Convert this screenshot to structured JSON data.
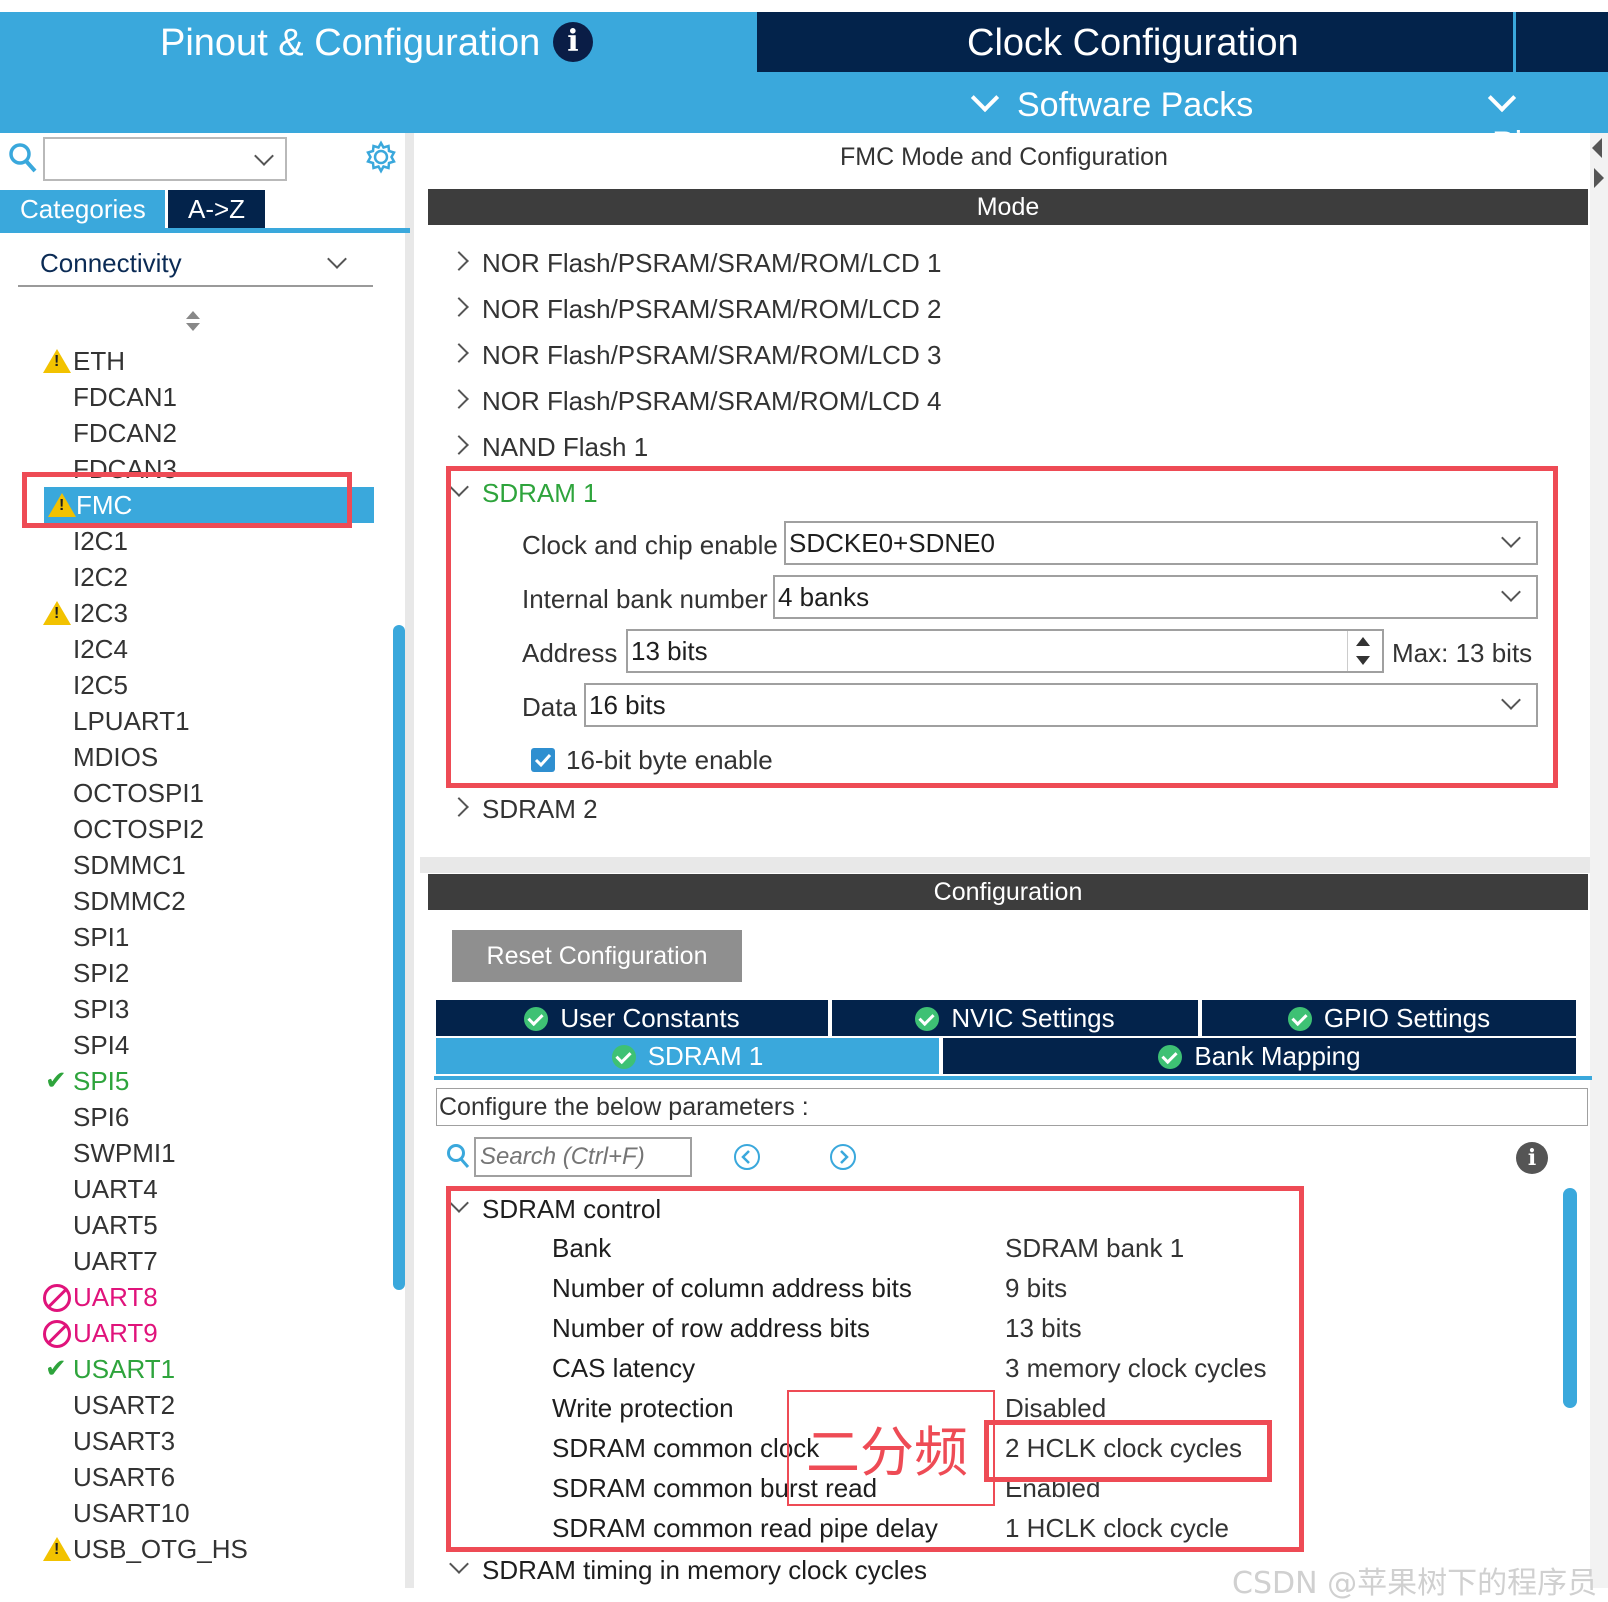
{
  "header": {
    "tabs": [
      "Pinout & Configuration",
      "Clock Configuration"
    ],
    "info_icon": "i",
    "subnav": [
      "Software Packs",
      "Pinou"
    ]
  },
  "sidebar": {
    "search_value": "",
    "tabs": [
      "Categories",
      "A->Z"
    ],
    "category": "Connectivity",
    "items": [
      {
        "label": "ETH",
        "status": "warning"
      },
      {
        "label": "FDCAN1",
        "status": "none"
      },
      {
        "label": "FDCAN2",
        "status": "none"
      },
      {
        "label": "FDCAN3",
        "status": "none"
      },
      {
        "label": "FMC",
        "status": "warning-selected"
      },
      {
        "label": "I2C1",
        "status": "none"
      },
      {
        "label": "I2C2",
        "status": "none"
      },
      {
        "label": "I2C3",
        "status": "warning"
      },
      {
        "label": "I2C4",
        "status": "none"
      },
      {
        "label": "I2C5",
        "status": "none"
      },
      {
        "label": "LPUART1",
        "status": "none"
      },
      {
        "label": "MDIOS",
        "status": "none"
      },
      {
        "label": "OCTOSPI1",
        "status": "none"
      },
      {
        "label": "OCTOSPI2",
        "status": "none"
      },
      {
        "label": "SDMMC1",
        "status": "none"
      },
      {
        "label": "SDMMC2",
        "status": "none"
      },
      {
        "label": "SPI1",
        "status": "none"
      },
      {
        "label": "SPI2",
        "status": "none"
      },
      {
        "label": "SPI3",
        "status": "none"
      },
      {
        "label": "SPI4",
        "status": "none"
      },
      {
        "label": "SPI5",
        "status": "ok"
      },
      {
        "label": "SPI6",
        "status": "none"
      },
      {
        "label": "SWPMI1",
        "status": "none"
      },
      {
        "label": "UART4",
        "status": "none"
      },
      {
        "label": "UART5",
        "status": "none"
      },
      {
        "label": "UART7",
        "status": "none"
      },
      {
        "label": "UART8",
        "status": "disabled"
      },
      {
        "label": "UART9",
        "status": "disabled"
      },
      {
        "label": "USART1",
        "status": "ok"
      },
      {
        "label": "USART2",
        "status": "none"
      },
      {
        "label": "USART3",
        "status": "none"
      },
      {
        "label": "USART6",
        "status": "none"
      },
      {
        "label": "USART10",
        "status": "none"
      },
      {
        "label": "USB_OTG_HS",
        "status": "warning"
      }
    ]
  },
  "main": {
    "title": "FMC Mode and Configuration",
    "mode_header": "Mode",
    "mode_rows": [
      "NOR Flash/PSRAM/SRAM/ROM/LCD 1",
      "NOR Flash/PSRAM/SRAM/ROM/LCD 2",
      "NOR Flash/PSRAM/SRAM/ROM/LCD 3",
      "NOR Flash/PSRAM/SRAM/ROM/LCD 4",
      "NAND Flash 1"
    ],
    "sdram1": {
      "label": "SDRAM 1",
      "clock_chip_enable_label": "Clock and chip enable",
      "clock_chip_enable_value": "SDCKE0+SDNE0",
      "internal_bank_label": "Internal bank number",
      "internal_bank_value": "4 banks",
      "address_label": "Address",
      "address_value": "13 bits",
      "address_max": "Max: 13 bits",
      "data_label": "Data",
      "data_value": "16 bits",
      "byte_enable_label": "16-bit byte enable",
      "byte_enable_checked": true
    },
    "sdram2_label": "SDRAM 2",
    "config_header": "Configuration",
    "reset_button": "Reset Configuration",
    "tabs_row1": [
      "User Constants",
      "NVIC Settings",
      "GPIO Settings"
    ],
    "tabs_row2": [
      "SDRAM 1",
      "Bank Mapping"
    ],
    "configure_text": "Configure the below parameters :",
    "search_placeholder": "Search (Ctrl+F)",
    "group": "SDRAM control",
    "params": [
      {
        "name": "Bank",
        "value": "SDRAM bank 1"
      },
      {
        "name": "Number of column address bits",
        "value": "9 bits"
      },
      {
        "name": "Number of row address bits",
        "value": "13 bits"
      },
      {
        "name": "CAS latency",
        "value": "3 memory clock cycles"
      },
      {
        "name": "Write protection",
        "value": "Disabled"
      },
      {
        "name": "SDRAM common clock",
        "value": "2 HCLK clock cycles"
      },
      {
        "name": "SDRAM common burst read",
        "value": "Enabled"
      },
      {
        "name": "SDRAM common read pipe delay",
        "value": "1 HCLK clock cycle"
      }
    ],
    "next_group": "SDRAM timing in memory clock cycles",
    "annotation": "二分频",
    "watermark": "CSDN @苹果树下的程序员"
  },
  "colors": {
    "accent": "#3aa8dc",
    "navy": "#03234b",
    "highlight_red": "#ee4b55",
    "ok_green": "#2ea43c",
    "warn_yellow": "#f2c200",
    "disabled_pink": "#e0137b"
  }
}
